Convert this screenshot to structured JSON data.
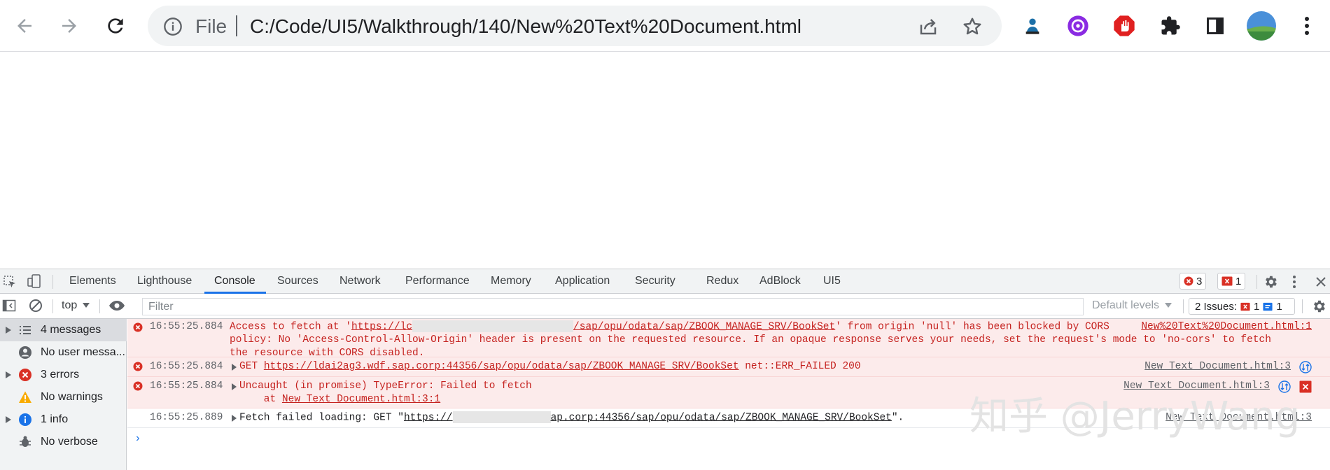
{
  "browser": {
    "scheme_label": "File",
    "url": "C:/Code/UI5/Walkthrough/140/New%20Text%20Document.html"
  },
  "devtools": {
    "tabs": [
      "Elements",
      "Lighthouse",
      "Console",
      "Sources",
      "Network",
      "Performance",
      "Memory",
      "Application",
      "Security",
      "Redux",
      "AdBlock",
      "UI5"
    ],
    "active_tab": "Console",
    "error_count": "3",
    "issue_count": "1",
    "context": "top",
    "filter_placeholder": "Filter",
    "default_levels": "Default levels",
    "issues_label": "2 Issues:",
    "issues_error": "1",
    "issues_info": "1"
  },
  "sidebar": {
    "items": [
      {
        "label": "4 messages",
        "icon": "list-icon"
      },
      {
        "label": "No user messa...",
        "icon": "user-icon"
      },
      {
        "label": "3 errors",
        "icon": "error-icon"
      },
      {
        "label": "No warnings",
        "icon": "warning-icon"
      },
      {
        "label": "1 info",
        "icon": "info-icon"
      },
      {
        "label": "No verbose",
        "icon": "verbose-icon"
      }
    ]
  },
  "messages": [
    {
      "time": "16:55:25.884",
      "line1_a": "Access to fetch at '",
      "line1_url_a": "https://lc",
      "line1_url_b": "/sap/opu/odata/sap/ZBOOK_MANAGE_SRV/BookSet",
      "line1_b": "' from origin 'null' has been blocked by CORS",
      "line2": "policy: No 'Access-Control-Allow-Origin' header is present on the requested resource. If an opaque response serves your needs, set the request's mode to 'no-cors' to fetch",
      "line3": "the resource with CORS disabled.",
      "source": "New%20Text%20Document.html:1"
    },
    {
      "time": "16:55:25.884",
      "method": "GET",
      "url": "https://ldai2ag3.wdf.sap.corp:44356/sap/opu/odata/sap/ZBOOK_MANAGE_SRV/BookSet",
      "status": "net::ERR_FAILED 200",
      "source": "New Text Document.html:3"
    },
    {
      "time": "16:55:25.884",
      "line1": "Uncaught (in promise) TypeError: Failed to fetch",
      "line2_a": "    at ",
      "line2_link": "New Text Document.html:3:1",
      "source": "New Text Document.html:3"
    },
    {
      "time": "16:55:25.889",
      "text_a": "Fetch failed loading: GET \"",
      "url_a": "https://",
      "url_b": "ap.corp:44356/sap/opu/odata/sap/ZBOOK_MANAGE_SRV/BookSet",
      "text_b": "\".",
      "source": "New Text Document.html:3"
    }
  ],
  "watermark": "知乎 @JerryWang",
  "colors": {
    "error_red": "#c5221f",
    "error_bg": "#fcebeb",
    "accent_blue": "#1a73e8"
  }
}
